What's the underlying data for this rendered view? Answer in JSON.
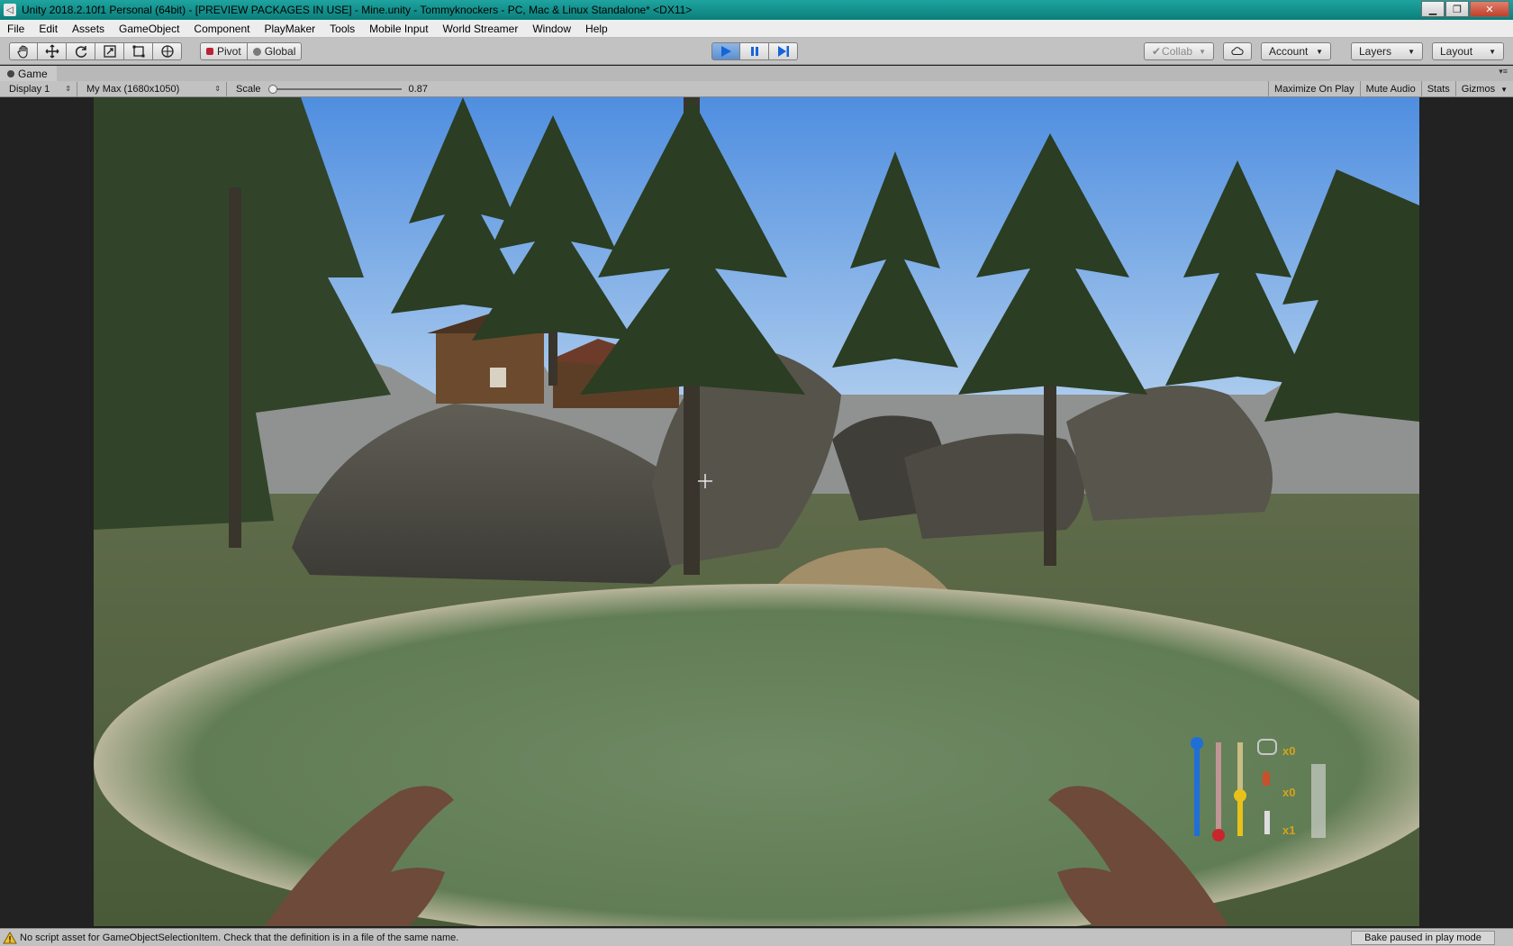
{
  "window": {
    "title": "Unity 2018.2.10f1 Personal (64bit) - [PREVIEW PACKAGES IN USE] - Mine.unity - Tommyknockers - PC, Mac & Linux Standalone* <DX11>"
  },
  "menu": [
    "File",
    "Edit",
    "Assets",
    "GameObject",
    "Component",
    "PlayMaker",
    "Tools",
    "Mobile Input",
    "World Streamer",
    "Window",
    "Help"
  ],
  "toolbar": {
    "pivot_label": "Pivot",
    "global_label": "Global",
    "collab_label": "Collab",
    "account_label": "Account",
    "layers_label": "Layers",
    "layout_label": "Layout"
  },
  "game_panel": {
    "tab_label": "Game",
    "display_label": "Display 1",
    "resolution_label": "My Max (1680x1050)",
    "scale_label": "Scale",
    "scale_value": "0.87",
    "toggles": [
      "Maximize On Play",
      "Mute Audio",
      "Stats",
      "Gizmos"
    ]
  },
  "hud": {
    "count_1": "x0",
    "count_2": "x0",
    "count_3": "x1",
    "levels": {
      "blue": 0.95,
      "red": 0.05,
      "yellow": 0.45
    },
    "colors": {
      "blue": "#1f6fd6",
      "red": "#c8262a",
      "yellow": "#e8c21a",
      "count": "#d7a21a"
    }
  },
  "status": {
    "message": "No script asset for GameObjectSelectionItem. Check that the definition is in a file of the same name.",
    "bake": "Bake paused in play mode"
  }
}
